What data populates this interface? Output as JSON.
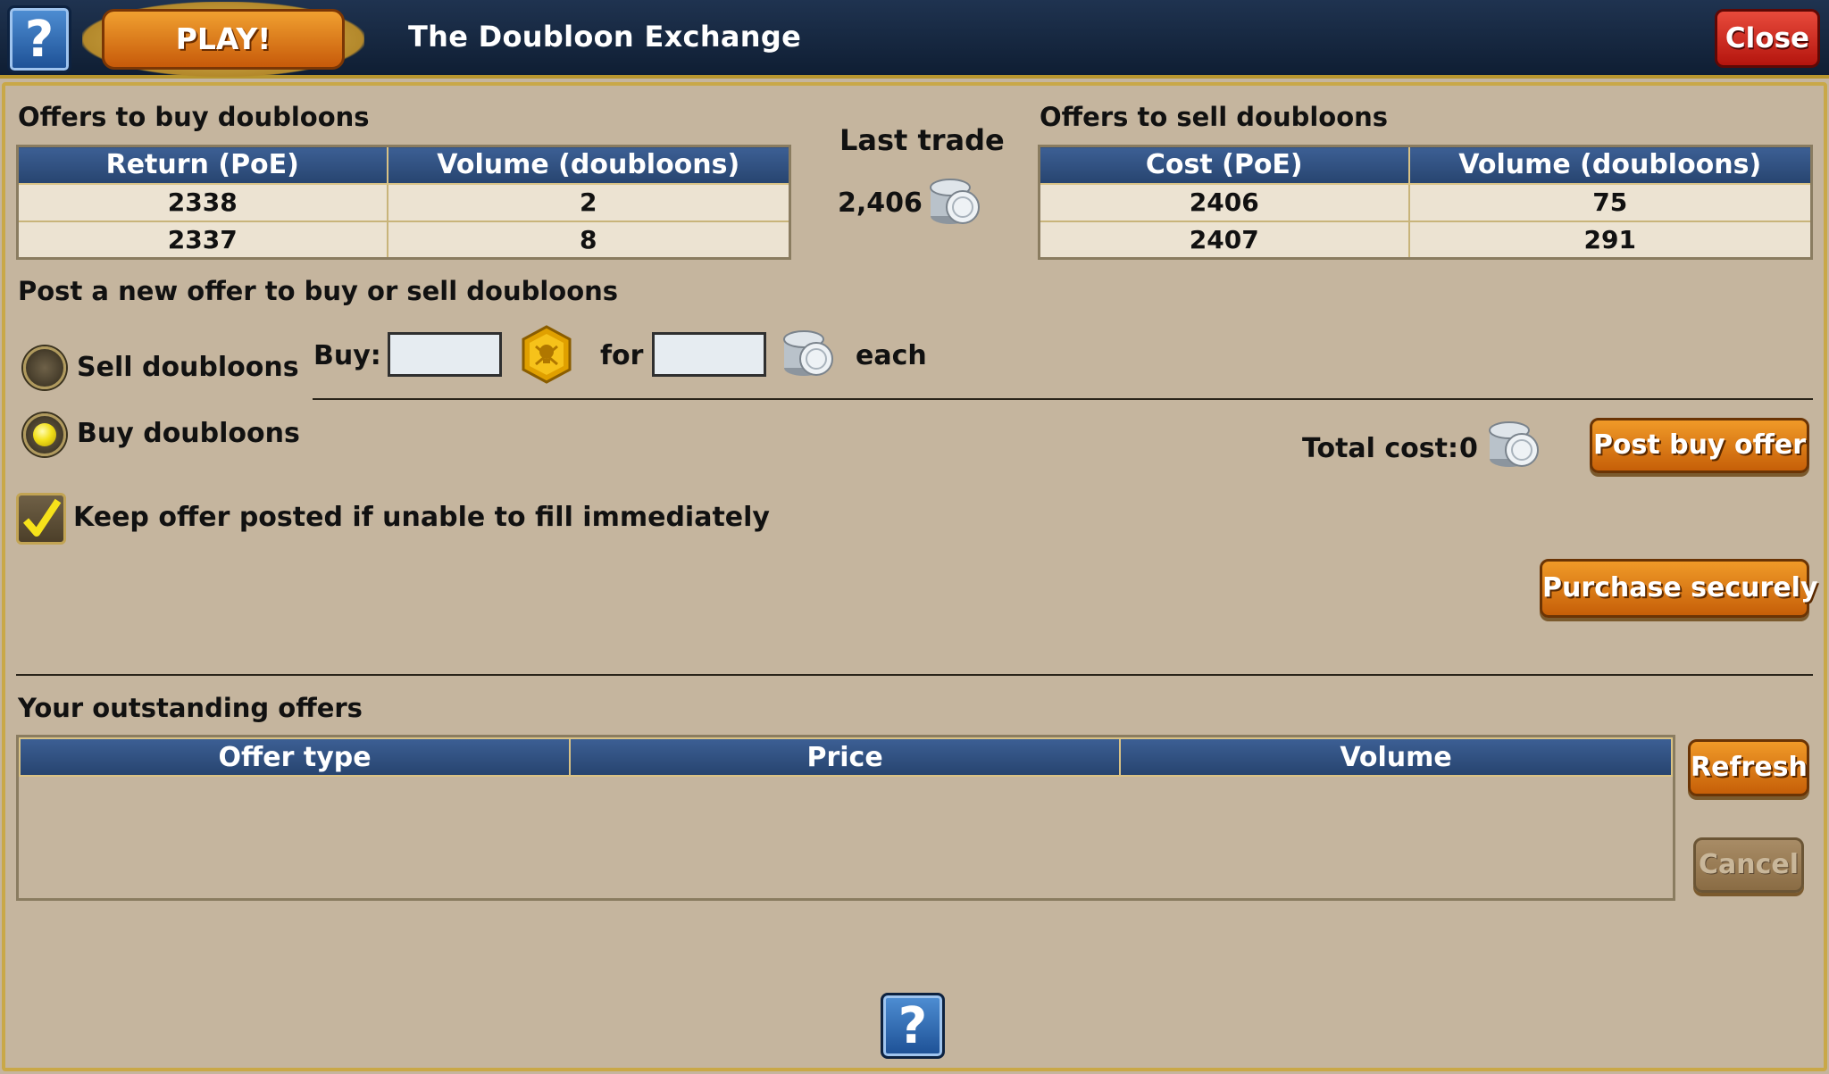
{
  "header": {
    "help_glyph": "?",
    "play_label": "PLAY!",
    "title": "The Doubloon Exchange",
    "close_label": "Close"
  },
  "buy_offers": {
    "title": "Offers to buy doubloons",
    "columns": [
      "Return (PoE)",
      "Volume (doubloons)"
    ],
    "rows": [
      {
        "price": "2338",
        "volume": "2"
      },
      {
        "price": "2337",
        "volume": "8"
      }
    ]
  },
  "last_trade": {
    "label": "Last trade",
    "value": "2,406"
  },
  "sell_offers": {
    "title": "Offers to sell doubloons",
    "columns": [
      "Cost (PoE)",
      "Volume (doubloons)"
    ],
    "rows": [
      {
        "price": "2406",
        "volume": "75"
      },
      {
        "price": "2407",
        "volume": "291"
      }
    ]
  },
  "new_offer": {
    "title": "Post a new offer to buy or sell doubloons",
    "sell_label": "Sell doubloons",
    "buy_label": "Buy doubloons",
    "selected": "buy",
    "buy_prefix": "Buy:",
    "for_label": "for",
    "each_label": "each",
    "quantity_value": "",
    "price_value": "",
    "total_label": "Total cost:",
    "total_value": "0",
    "post_button": "Post buy offer",
    "keep_posted_label": "Keep offer posted if unable to fill immediately",
    "keep_posted_checked": true,
    "purchase_button": "Purchase securely"
  },
  "outstanding": {
    "title": "Your outstanding offers",
    "columns": [
      "Offer type",
      "Price",
      "Volume"
    ],
    "rows": [],
    "refresh_button": "Refresh",
    "cancel_button": "Cancel"
  },
  "footer": {
    "help_glyph": "?"
  },
  "icons": {
    "coin": "silver-coin-stack-icon",
    "doubloon": "gold-doubloon-icon",
    "help": "question-mark-icon",
    "check": "checkmark-icon"
  },
  "colors": {
    "background": "#c5b59e",
    "header_bar": "#1a2b45",
    "table_header": "#31507f",
    "button_orange": "#e07a16",
    "close_red": "#c9261a"
  }
}
